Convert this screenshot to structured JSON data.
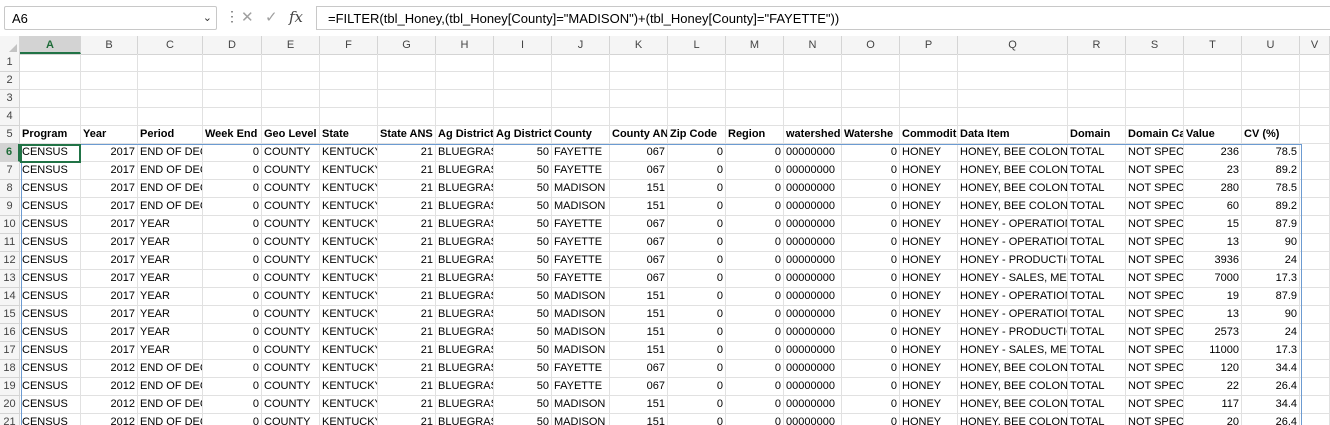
{
  "name_box": "A6",
  "formula": "=FILTER(tbl_Honey,(tbl_Honey[County]=\"MADISON\")+(tbl_Honey[County]=\"FAYETTE\"))",
  "icons": {
    "dropdown": "chevron-down-icon",
    "more": "more-dots-icon",
    "cancel": "cancel-x-icon",
    "enter": "checkmark-icon",
    "function": "fx-icon"
  },
  "columns": [
    "A",
    "B",
    "C",
    "D",
    "E",
    "F",
    "G",
    "H",
    "I",
    "J",
    "K",
    "L",
    "M",
    "N",
    "O",
    "P",
    "Q",
    "R",
    "S",
    "T",
    "U",
    "V"
  ],
  "row_numbers": [
    "1",
    "2",
    "3",
    "4",
    "5",
    "6",
    "7",
    "8",
    "9",
    "10",
    "11",
    "12",
    "13",
    "14",
    "15",
    "16",
    "17",
    "18",
    "19",
    "20",
    "21"
  ],
  "headers": [
    "Program",
    "Year",
    "Period",
    "Week End",
    "Geo Level",
    "State",
    "State ANS",
    "Ag District",
    "Ag District",
    "County",
    "County AN",
    "Zip Code",
    "Region",
    "watershed",
    "Watershe",
    "Commodit",
    "Data Item",
    "Domain",
    "Domain Ca",
    "Value",
    "CV (%)"
  ],
  "rows": [
    [
      "CENSUS",
      "2017",
      "END OF DEC",
      "0",
      "COUNTY",
      "KENTUCKY",
      "21",
      "BLUEGRAS",
      "50",
      "FAYETTE",
      "067",
      "0",
      "0",
      "00000000",
      "0",
      "HONEY",
      "HONEY, BEE COLONI",
      "TOTAL",
      "NOT SPECI",
      "236",
      "78.5"
    ],
    [
      "CENSUS",
      "2017",
      "END OF DEC",
      "0",
      "COUNTY",
      "KENTUCKY",
      "21",
      "BLUEGRAS",
      "50",
      "FAYETTE",
      "067",
      "0",
      "0",
      "00000000",
      "0",
      "HONEY",
      "HONEY, BEE COLONI",
      "TOTAL",
      "NOT SPECI",
      "23",
      "89.2"
    ],
    [
      "CENSUS",
      "2017",
      "END OF DEC",
      "0",
      "COUNTY",
      "KENTUCKY",
      "21",
      "BLUEGRAS",
      "50",
      "MADISON",
      "151",
      "0",
      "0",
      "00000000",
      "0",
      "HONEY",
      "HONEY, BEE COLONI",
      "TOTAL",
      "NOT SPECI",
      "280",
      "78.5"
    ],
    [
      "CENSUS",
      "2017",
      "END OF DEC",
      "0",
      "COUNTY",
      "KENTUCKY",
      "21",
      "BLUEGRAS",
      "50",
      "MADISON",
      "151",
      "0",
      "0",
      "00000000",
      "0",
      "HONEY",
      "HONEY, BEE COLONI",
      "TOTAL",
      "NOT SPECI",
      "60",
      "89.2"
    ],
    [
      "CENSUS",
      "2017",
      "YEAR",
      "0",
      "COUNTY",
      "KENTUCKY",
      "21",
      "BLUEGRAS",
      "50",
      "FAYETTE",
      "067",
      "0",
      "0",
      "00000000",
      "0",
      "HONEY",
      "HONEY - OPERATION",
      "TOTAL",
      "NOT SPECI",
      "15",
      "87.9"
    ],
    [
      "CENSUS",
      "2017",
      "YEAR",
      "0",
      "COUNTY",
      "KENTUCKY",
      "21",
      "BLUEGRAS",
      "50",
      "FAYETTE",
      "067",
      "0",
      "0",
      "00000000",
      "0",
      "HONEY",
      "HONEY - OPERATION",
      "TOTAL",
      "NOT SPECI",
      "13",
      "90"
    ],
    [
      "CENSUS",
      "2017",
      "YEAR",
      "0",
      "COUNTY",
      "KENTUCKY",
      "21",
      "BLUEGRAS",
      "50",
      "FAYETTE",
      "067",
      "0",
      "0",
      "00000000",
      "0",
      "HONEY",
      "HONEY - PRODUCTIO",
      "TOTAL",
      "NOT SPECI",
      "3936",
      "24"
    ],
    [
      "CENSUS",
      "2017",
      "YEAR",
      "0",
      "COUNTY",
      "KENTUCKY",
      "21",
      "BLUEGRAS",
      "50",
      "FAYETTE",
      "067",
      "0",
      "0",
      "00000000",
      "0",
      "HONEY",
      "HONEY - SALES, MEA",
      "TOTAL",
      "NOT SPECI",
      "7000",
      "17.3"
    ],
    [
      "CENSUS",
      "2017",
      "YEAR",
      "0",
      "COUNTY",
      "KENTUCKY",
      "21",
      "BLUEGRAS",
      "50",
      "MADISON",
      "151",
      "0",
      "0",
      "00000000",
      "0",
      "HONEY",
      "HONEY - OPERATION",
      "TOTAL",
      "NOT SPECI",
      "19",
      "87.9"
    ],
    [
      "CENSUS",
      "2017",
      "YEAR",
      "0",
      "COUNTY",
      "KENTUCKY",
      "21",
      "BLUEGRAS",
      "50",
      "MADISON",
      "151",
      "0",
      "0",
      "00000000",
      "0",
      "HONEY",
      "HONEY - OPERATION",
      "TOTAL",
      "NOT SPECI",
      "13",
      "90"
    ],
    [
      "CENSUS",
      "2017",
      "YEAR",
      "0",
      "COUNTY",
      "KENTUCKY",
      "21",
      "BLUEGRAS",
      "50",
      "MADISON",
      "151",
      "0",
      "0",
      "00000000",
      "0",
      "HONEY",
      "HONEY - PRODUCTIO",
      "TOTAL",
      "NOT SPECI",
      "2573",
      "24"
    ],
    [
      "CENSUS",
      "2017",
      "YEAR",
      "0",
      "COUNTY",
      "KENTUCKY",
      "21",
      "BLUEGRAS",
      "50",
      "MADISON",
      "151",
      "0",
      "0",
      "00000000",
      "0",
      "HONEY",
      "HONEY - SALES, MEA",
      "TOTAL",
      "NOT SPECI",
      "11000",
      "17.3"
    ],
    [
      "CENSUS",
      "2012",
      "END OF DEC",
      "0",
      "COUNTY",
      "KENTUCKY",
      "21",
      "BLUEGRAS",
      "50",
      "FAYETTE",
      "067",
      "0",
      "0",
      "00000000",
      "0",
      "HONEY",
      "HONEY, BEE COLONI",
      "TOTAL",
      "NOT SPECI",
      "120",
      "34.4"
    ],
    [
      "CENSUS",
      "2012",
      "END OF DEC",
      "0",
      "COUNTY",
      "KENTUCKY",
      "21",
      "BLUEGRAS",
      "50",
      "FAYETTE",
      "067",
      "0",
      "0",
      "00000000",
      "0",
      "HONEY",
      "HONEY, BEE COLONI",
      "TOTAL",
      "NOT SPECI",
      "22",
      "26.4"
    ],
    [
      "CENSUS",
      "2012",
      "END OF DEC",
      "0",
      "COUNTY",
      "KENTUCKY",
      "21",
      "BLUEGRAS",
      "50",
      "MADISON",
      "151",
      "0",
      "0",
      "00000000",
      "0",
      "HONEY",
      "HONEY, BEE COLONI",
      "TOTAL",
      "NOT SPECI",
      "117",
      "34.4"
    ],
    [
      "CENSUS",
      "2012",
      "END OF DEC",
      "0",
      "COUNTY",
      "KENTUCKY",
      "21",
      "BLUEGRAS",
      "50",
      "MADISON",
      "151",
      "0",
      "0",
      "00000000",
      "0",
      "HONEY",
      "HONEY, BEE COLONI",
      "TOTAL",
      "NOT SPECI",
      "20",
      "26.4"
    ]
  ],
  "colors": {
    "selection": "#217346",
    "spill_border": "#6c9bd1",
    "gridline": "#e1e1e1",
    "header_bg": "#f5f5f5"
  }
}
